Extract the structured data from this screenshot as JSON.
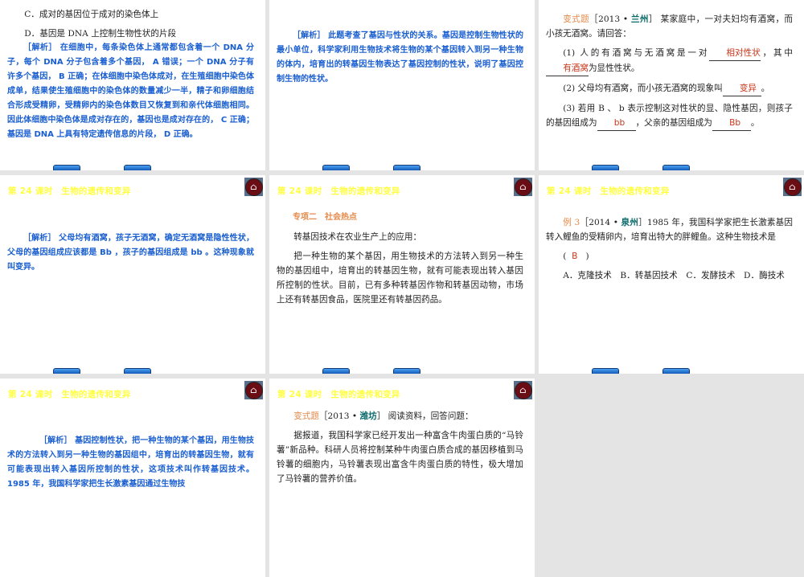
{
  "header": "第 24 课时　生物的遗传和变异",
  "s1": {
    "c": "C．成对的基因位于成对的染色体上",
    "d": "D．基因是 DNA 上控制生物性状的片段",
    "analysis": "［解析］ 在细胞中，每条染色体上通常都包含着一个 DNA 分子，每个 DNA 分子包含着多个基因， A 错误；一个 DNA 分子有许多个基因， B 正确；在体细胞中染色体成对，在生殖细胞中染色体成单，结果使生殖细胞中的染色体的数量减少一半，精子和卵细胞结合形成受精卵，受精卵内的染色体数目又恢复到和亲代体细胞相同。因此体细胞中染色体是成对存在的，基因也是成对存在的， C 正确；基因是 DNA 上具有特定遗传信息的片段， D 正确。"
  },
  "s2": {
    "analysis": "［解析］ 此题考查了基因与性状的关系。基因是控制生物性状的最小单位，科学家利用生物技术将生物的某个基因转入到另一种生物的体内，培育出的转基因生物表达了基因控制的性状，说明了基因控制生物的性状。"
  },
  "s3": {
    "tag": "变式题",
    "src_a": "［2013 • ",
    "src_city": "兰州",
    "src_b": "］",
    "stem": " 某家庭中，一对夫妇均有酒窝，而小孩无酒窝。请回答：",
    "q1a": "(1) 人的有酒窝与无酒窝是一对",
    "a1": "相对性状",
    "q1b": "，其中",
    "a1b": "有酒窝",
    "q1c": "为显性性状。",
    "q2a": "(2) 父母均有酒窝，而小孩无酒窝的现象叫",
    "a2": "变异",
    "q2b": "。",
    "q3a": "(3) 若用 B 、 b 表示控制这对性状的显、隐性基因，则孩子的基因组成为",
    "a3": "bb",
    "q3b": "，父亲的基因组成为",
    "a3b": "Bb",
    "q3c": "。"
  },
  "s4": {
    "analysis": "［解析］ 父母均有酒窝，孩子无酒窝，确定无酒窝是隐性性状，父母的基因组成应该都是 Bb ，孩子的基因组成是 bb 。这种现象就叫变异。"
  },
  "s5": {
    "title": "专项二　社会热点",
    "p1": "转基因技术在农业生产上的应用：",
    "p2": "把一种生物的某个基因，用生物技术的方法转入到另一种生物的基因组中，培育出的转基因生物，就有可能表现出转入基因所控制的性状。目前，已有多种转基因作物和转基因动物，市场上还有转基因食品，医院里还有转基因药品。"
  },
  "s6": {
    "tag": "例 3",
    "src_a": "［2014 • ",
    "src_city": "泉州",
    "src_b": "］",
    "stem": "1985 年，我国科学家把生长激素基因转入鲤鱼的受精卵内，培育出特大的胖鲤鱼。这种生物技术是",
    "open": "(",
    "ans": "B",
    "close": ")",
    "options": "A．克隆技术　B．转基因技术　C．发酵技术　D．酶技术"
  },
  "s7": {
    "analysis": "［解析］ 基因控制性状，把一种生物的某个基因，用生物技术的方法转入到另一种生物的基因组中，培育出的转基因生物，就有可能表现出转入基因所控制的性状，这项技术叫作转基因技术。1985 年，我国科学家把生长激素基因通过生物技"
  },
  "s8": {
    "tag": "变式题",
    "src_a": "［2013 • ",
    "src_city": "潍坊",
    "src_b": "］",
    "stem": " 阅读资料，回答问题：",
    "p": "据报道，我国科学家已经开发出一种富含牛肉蛋白质的“马铃薯”新品种。科研人员将控制某种牛肉蛋白质合成的基因移植到马铃薯的细胞内，马铃薯表现出富含牛肉蛋白质的特性，极大增加了马铃薯的营养价值。"
  }
}
